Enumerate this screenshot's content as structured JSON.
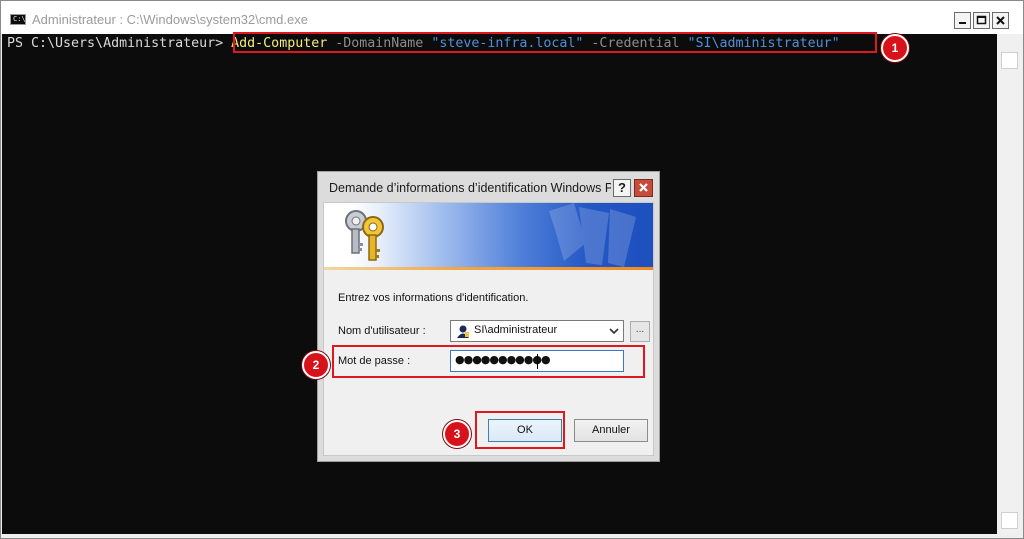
{
  "window": {
    "title": "Administrateur : C:\\Windows\\system32\\cmd.exe",
    "icon": "cmd-console-icon",
    "controls": [
      "minimize-icon",
      "maximize-icon",
      "close-icon"
    ]
  },
  "console": {
    "prompt": "PS C:\\Users\\Administrateur> ",
    "command": "Add-Computer",
    "param1": " -DomainName ",
    "value1": "\"steve-infra.local\"",
    "param2": " -Credential ",
    "value2": "\"SI\\administrateur\"",
    "colors": {
      "background": "#0c0c0c",
      "command": "#f3eb7a",
      "parameter": "#8c8c8c",
      "string": "#4f8fd9"
    }
  },
  "dialog": {
    "title": "Demande d’informations d’identification Windows PowerShell",
    "help_label": "?",
    "instructions": "Entrez vos informations d'identification.",
    "username_label": "Nom d'utilisateur :",
    "username_value": "SI\\administrateur",
    "password_label": "Mot de passe :",
    "password_value": "●●●●●●●●●●●",
    "browse_label": "...",
    "ok_label": "OK",
    "cancel_label": "Annuler",
    "icons": [
      "keys-icon",
      "user-icon",
      "chevron-down-icon"
    ]
  },
  "annotations": {
    "step1": "1",
    "step2": "2",
    "step3": "3",
    "color": "#e0181e"
  }
}
